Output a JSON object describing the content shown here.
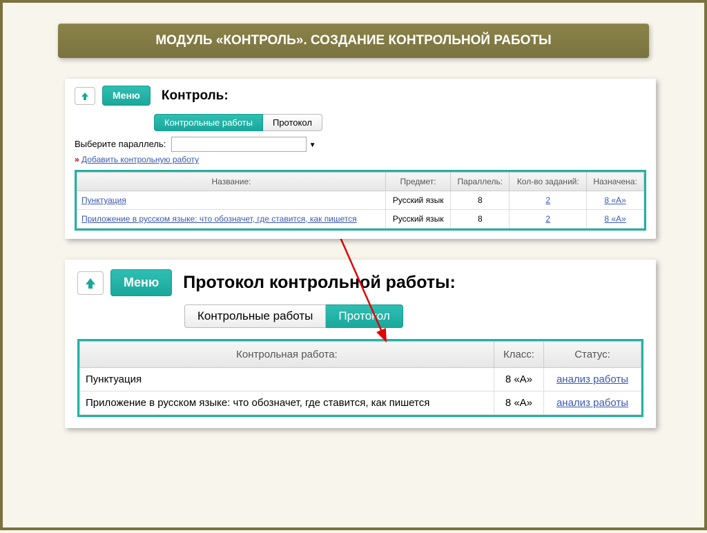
{
  "title": "МОДУЛЬ «КОНТРОЛЬ». СОЗДАНИЕ КОНТРОЛЬНОЙ РАБОТЫ",
  "panel1": {
    "menu_label": "Меню",
    "section_title": "Контроль:",
    "tab_works": "Контрольные работы",
    "tab_protocol": "Протокол",
    "select_label": "Выберите параллель:",
    "add_link": "Добавить контрольную работу",
    "headers": {
      "name": "Название:",
      "subject": "Предмет:",
      "parallel": "Параллель:",
      "tasks": "Кол-во заданий:",
      "assigned": "Назначена:"
    },
    "rows": [
      {
        "name": "Пунктуация",
        "subject": "Русский язык",
        "parallel": "8",
        "tasks": "2",
        "assigned": "8 «А»"
      },
      {
        "name": "Приложение в русском языке: что обозначет, где ставится, как пишется",
        "subject": "Русский язык",
        "parallel": "8",
        "tasks": "2",
        "assigned": "8 «А»"
      }
    ]
  },
  "panel2": {
    "menu_label": "Меню",
    "section_title": "Протокол контрольной работы:",
    "tab_works": "Контрольные работы",
    "tab_protocol": "Протокол",
    "headers": {
      "work": "Контрольная работа:",
      "class": "Класс:",
      "status": "Статус:"
    },
    "rows": [
      {
        "work": "Пунктуация",
        "class": "8 «А»",
        "status": "анализ работы"
      },
      {
        "work": "Приложение в русском языке: что обозначет, где ставится, как пишется",
        "class": "8 «А»",
        "status": "анализ работы"
      }
    ]
  }
}
